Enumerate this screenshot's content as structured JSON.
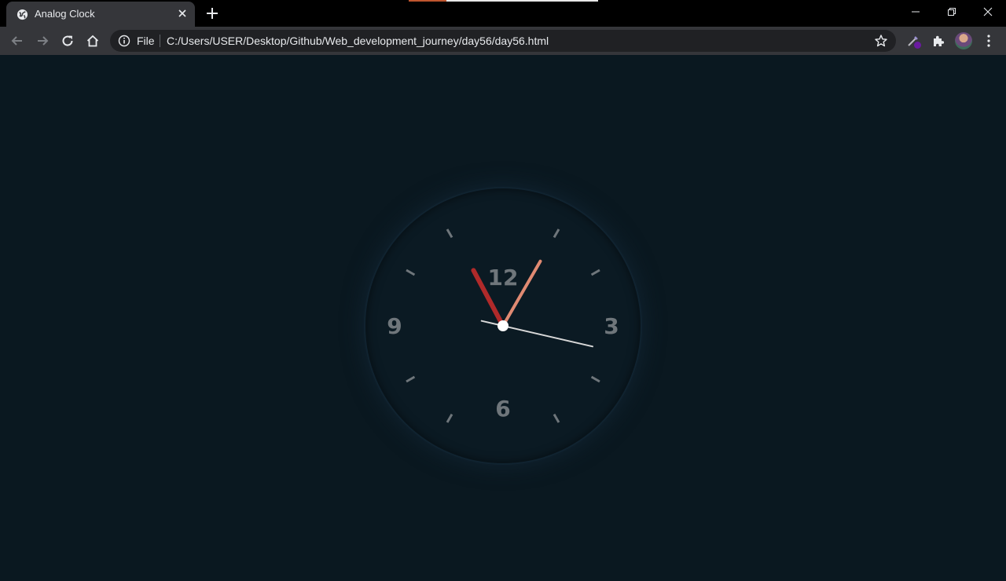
{
  "tab": {
    "title": "Analog Clock",
    "favicon": "globe-icon"
  },
  "omnibox": {
    "scheme_label": "File",
    "url": "C:/Users/USER/Desktop/Github/Web_development_journey/day56/day56.html"
  },
  "clock": {
    "numerals": {
      "twelve": "12",
      "three": "3",
      "six": "6",
      "nine": "9"
    },
    "hour_hand_angle": -28,
    "minute_hand_angle": 30,
    "second_hand_angle": 103,
    "colors": {
      "face": "#0b1a23",
      "hour_hand": "#b02a2a",
      "minute_hand": "#e08a72",
      "second_hand": "#d8d8d8",
      "ticks": "#6f767b",
      "center": "#ffffff"
    }
  },
  "colors": {
    "page_background": "#0a1820",
    "toolbar": "#35363a",
    "titlebar": "#000000"
  }
}
